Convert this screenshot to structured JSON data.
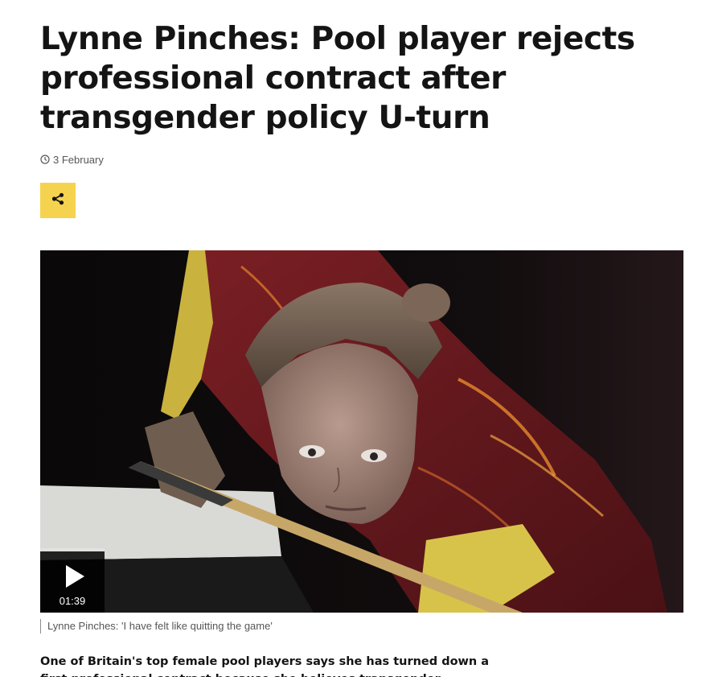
{
  "article": {
    "headline": "Lynne Pinches: Pool player rejects professional contract after transgender policy U-turn",
    "date": "3 February",
    "share_icon": "share-icon",
    "clock_icon": "clock-icon"
  },
  "video": {
    "duration": "01:39",
    "play_icon": "play-icon",
    "caption": "Lynne Pinches: 'I have felt like quitting the game'"
  },
  "body": {
    "intro": "One of Britain's top female pool players says she has turned down a first professional contract because she believes transgender women shouldn't compete"
  },
  "colors": {
    "share_button": "#f6d34e",
    "headline_text": "#141414",
    "meta_text": "#545658"
  }
}
